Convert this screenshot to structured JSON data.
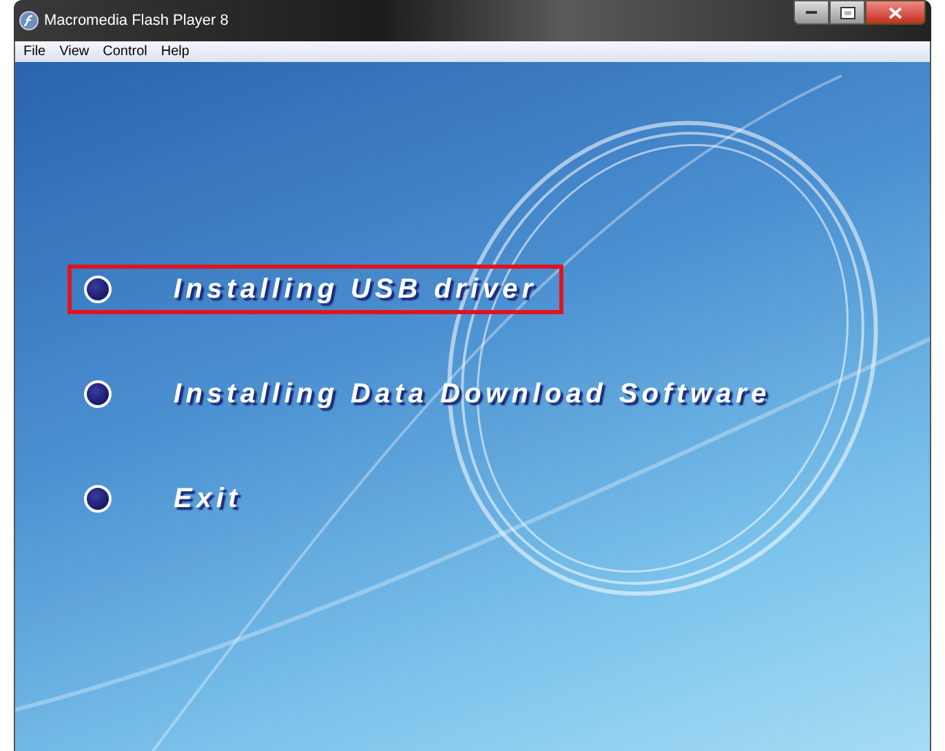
{
  "window": {
    "title": "Macromedia Flash Player 8"
  },
  "menu": [
    "File",
    "View",
    "Control",
    "Help"
  ],
  "options": [
    {
      "label": "Installing USB driver",
      "selected": true
    },
    {
      "label": "Installing Data Download Software",
      "selected": false
    },
    {
      "label": "Exit",
      "selected": false
    }
  ]
}
